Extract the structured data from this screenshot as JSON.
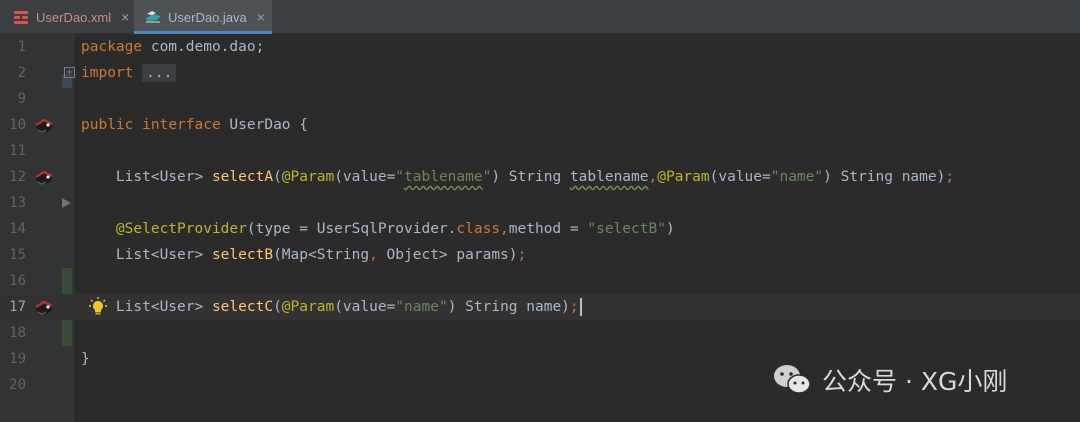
{
  "tabs": [
    {
      "label": "UserDao.xml",
      "close": "×",
      "icon": "xml-file-icon",
      "active": false
    },
    {
      "label": "UserDao.java",
      "close": "×",
      "icon": "java-interface-icon",
      "active": true
    }
  ],
  "editor": {
    "line_numbers": [
      "1",
      "2",
      "9",
      "10",
      "11",
      "12",
      "13",
      "14",
      "15",
      "16",
      "17",
      "18",
      "19",
      "20"
    ],
    "current_line": "17",
    "lines": {
      "l1": {
        "kw": "package",
        "rest": " com.demo.dao;"
      },
      "l2": {
        "kw": "import",
        "folded": "..."
      },
      "l10": {
        "kw1": "public",
        "kw2": "interface",
        "name": " UserDao {"
      },
      "l12": {
        "p1": "List<User> ",
        "fn": "selectA",
        "p2": "(",
        "an1": "@Param",
        "p3": "(value=",
        "s1": "\"",
        "s1b": "tablename",
        "s1c": "\"",
        "p4": ") String ",
        "sq": "tablename",
        "comma": ",",
        "an2": "@Param",
        "p5": "(value=",
        "s2": "\"name\"",
        "p6": ") String name)",
        "semi": ";"
      },
      "l14": {
        "an": "@SelectProvider",
        "p1": "(type = UserSqlProvider.",
        "kw": "class",
        "comma": ",",
        "p2": "method = ",
        "s": "\"selectB\"",
        "p3": ")"
      },
      "l15": {
        "p1": "List<User> ",
        "fn": "selectB",
        "p2": "(Map<String",
        "comma": ",",
        "p3": " Object> params)",
        "semi": ";"
      },
      "l17": {
        "p1": "List<User> ",
        "fn": "selectC",
        "p2": "(",
        "an": "@Param",
        "p3": "(value=",
        "s": "\"name\"",
        "p4": ") String name)",
        "semi": ";"
      },
      "l19": {
        "text": "}"
      }
    }
  },
  "watermark": {
    "text": "公众号 · XG小刚",
    "icon": "wechat-icon"
  }
}
